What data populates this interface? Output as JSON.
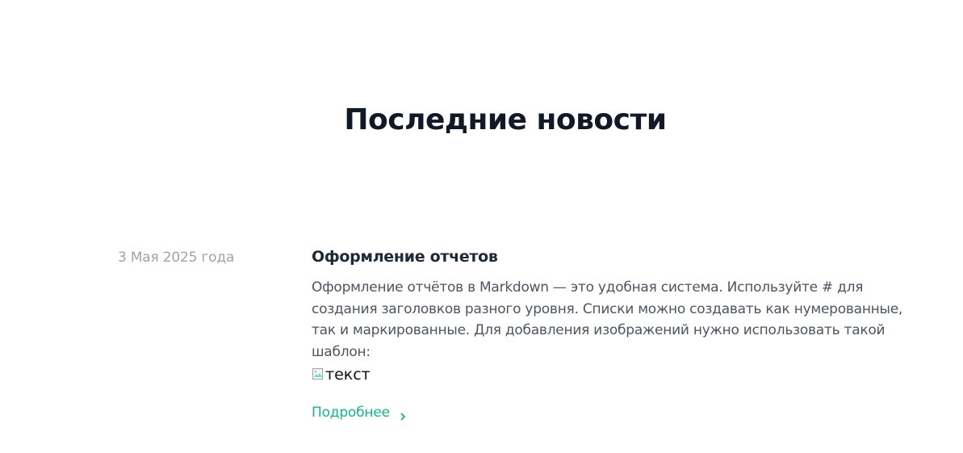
{
  "section": {
    "title": "Последние новости"
  },
  "news": {
    "date": "3 Мая 2025 года",
    "title": "Оформление отчетов",
    "text": "Оформление отчётов в Markdown — это удобная система. Используйте # для создания заголовков разного уровня. Списки можно создавать как нумерованные, так и маркированные. Для добавления изображений нужно использовать такой шаблон:",
    "image_alt": "текст",
    "more_label": "Подробнее",
    "more_icon": "chevron-right-icon",
    "image_icon": "broken-image-icon"
  },
  "colors": {
    "title": "#111827",
    "date": "#9ca3af",
    "text": "#4b5563",
    "accent": "#10b981"
  }
}
